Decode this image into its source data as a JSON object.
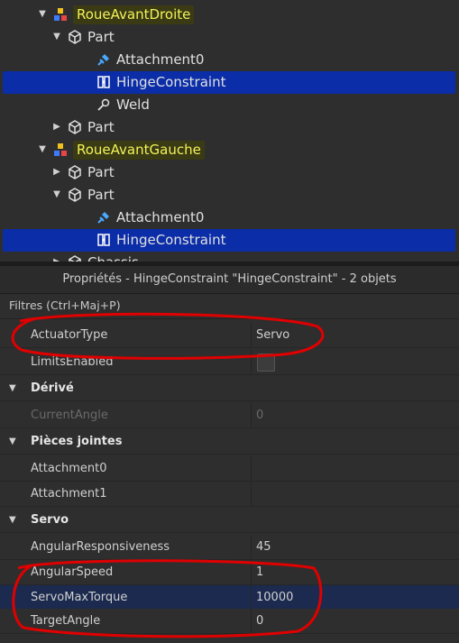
{
  "explorer": {
    "rows": [
      {
        "label": "RoueAvantDroite",
        "kind": "model",
        "expanded": true
      },
      {
        "label": "Part",
        "kind": "part",
        "expanded": true
      },
      {
        "label": "Attachment0",
        "kind": "attachment"
      },
      {
        "label": "HingeConstraint",
        "kind": "hinge",
        "selected": true
      },
      {
        "label": "Weld",
        "kind": "weld"
      },
      {
        "label": "Part",
        "kind": "part",
        "expanded": false
      },
      {
        "label": "RoueAvantGauche",
        "kind": "model",
        "expanded": true
      },
      {
        "label": "Part",
        "kind": "part",
        "expanded": false
      },
      {
        "label": "Part",
        "kind": "part",
        "expanded": true
      },
      {
        "label": "Attachment0",
        "kind": "attachment"
      },
      {
        "label": "HingeConstraint",
        "kind": "hinge",
        "selected": true
      },
      {
        "label": "Chassis",
        "kind": "part",
        "expanded": false
      }
    ],
    "colors": {
      "selection": "#0b2da8",
      "model_highlight": "#f3f35a"
    }
  },
  "properties": {
    "title": "Propriétés - HingeConstraint \"HingeConstraint\" - 2 objets",
    "filter_placeholder": "Filtres (Ctrl+Maj+P)",
    "rows": [
      {
        "name": "ActuatorType",
        "value": "Servo"
      },
      {
        "name": "LimitsEnabled",
        "value": "",
        "checkbox": true
      },
      {
        "section": "Dérivé"
      },
      {
        "name": "CurrentAngle",
        "value": "0",
        "dim": true
      },
      {
        "section": "Pièces jointes"
      },
      {
        "name": "Attachment0",
        "value": ""
      },
      {
        "name": "Attachment1",
        "value": ""
      },
      {
        "section": "Servo"
      },
      {
        "name": "AngularResponsiveness",
        "value": "45"
      },
      {
        "name": "AngularSpeed",
        "value": "1"
      },
      {
        "name": "ServoMaxTorque",
        "value": "10000",
        "selected": true
      },
      {
        "name": "TargetAngle",
        "value": "0"
      }
    ]
  },
  "icons": {
    "model": "model-icon",
    "part": "part-cube-icon",
    "attachment": "attachment-plug-icon",
    "hinge": "hinge-constraint-icon",
    "weld": "weld-icon",
    "expand": "chevron-down-icon",
    "collapse": "chevron-right-icon"
  },
  "colors": {
    "annotation": "#e00000",
    "background": "#2e2e2e"
  }
}
